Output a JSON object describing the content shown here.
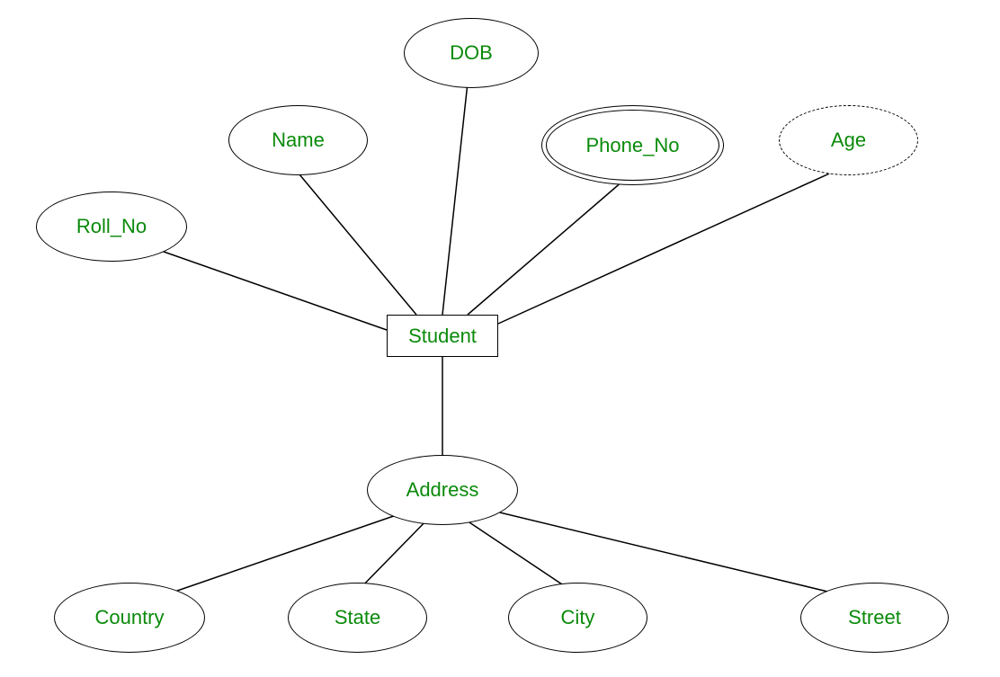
{
  "entity": {
    "label": "Student"
  },
  "attributes": {
    "roll_no": "Roll_No",
    "name": "Name",
    "dob": "DOB",
    "phone_no": "Phone_No",
    "age": "Age",
    "address": "Address"
  },
  "sub_attributes": {
    "country": "Country",
    "state": "State",
    "city": "City",
    "street": "Street"
  }
}
